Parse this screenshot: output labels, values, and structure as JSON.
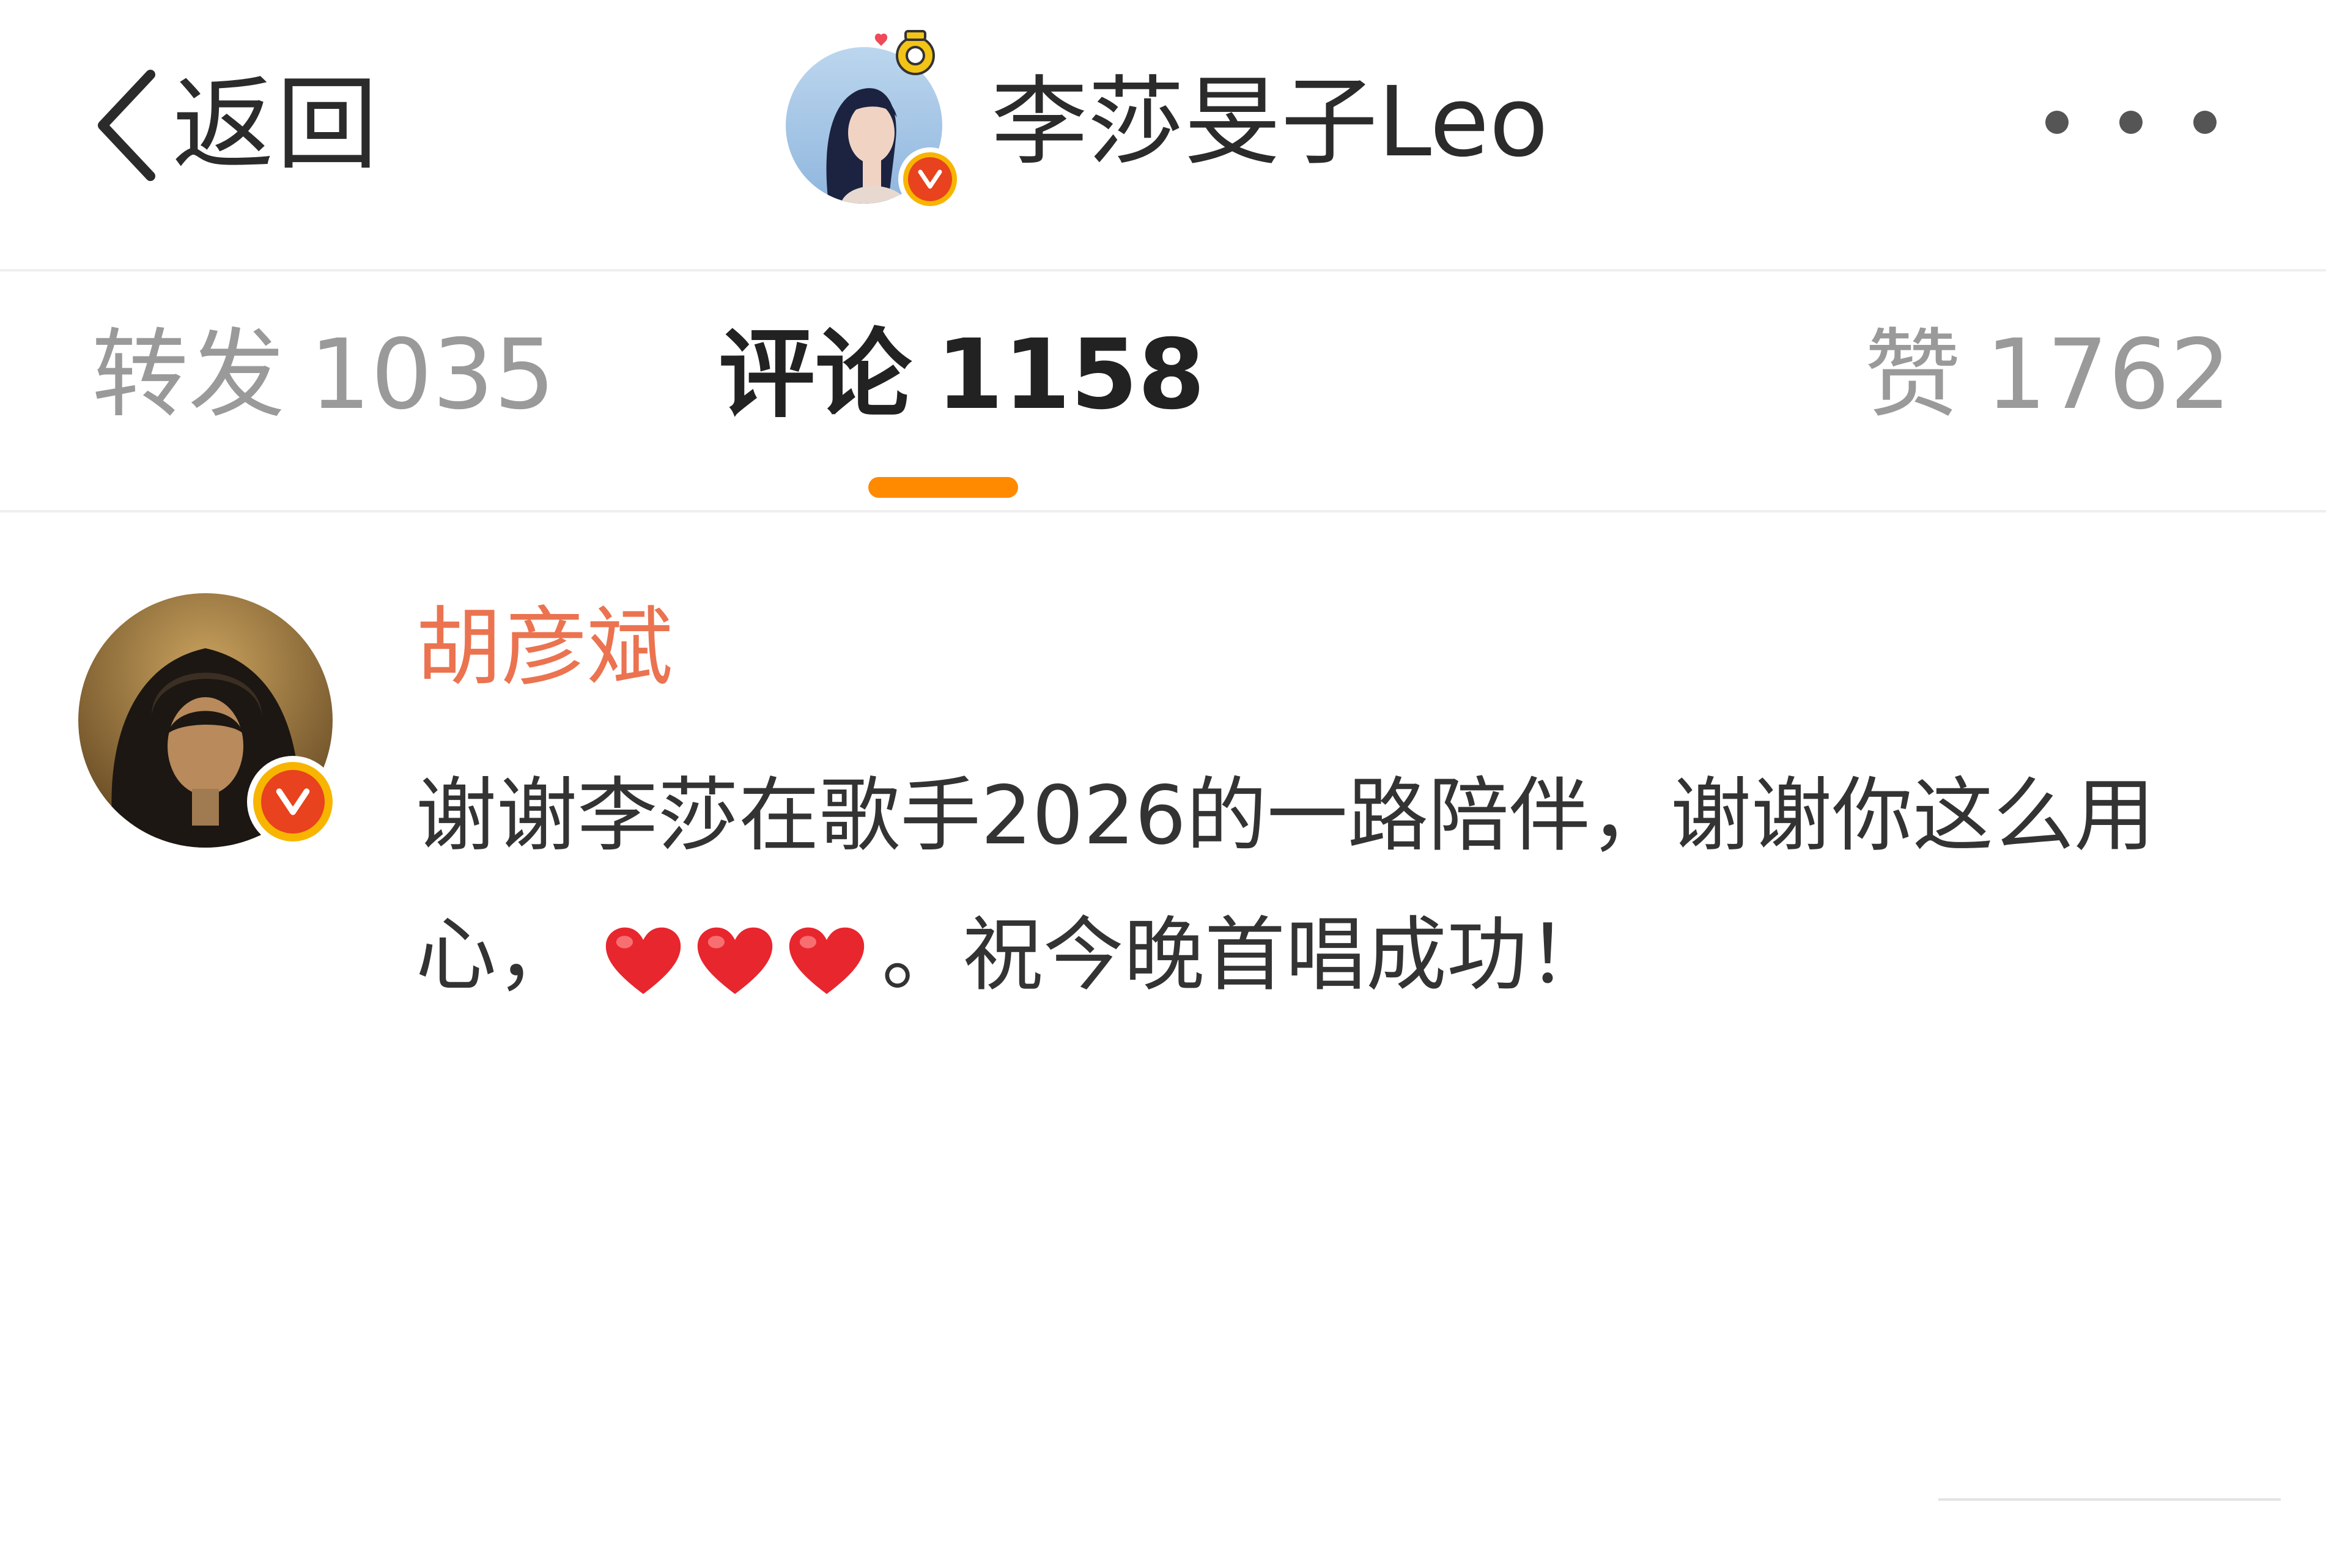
{
  "header": {
    "back_label": "返回",
    "profile_name": "李莎旻子Leo",
    "more_icon": "more-dots-icon"
  },
  "tabs": [
    {
      "label": "转发",
      "count": "1035",
      "active": false
    },
    {
      "label": "评论",
      "count": "1158",
      "active": true
    },
    {
      "label": "赞",
      "count": "1762",
      "active": false
    }
  ],
  "comment": {
    "author": "胡彦斌",
    "text_before": "谢谢李莎在歌手2026的一路陪伴，谢谢你这么用心，",
    "emoji": [
      "red-heart",
      "red-heart",
      "red-heart"
    ],
    "text_after": "。祝今晚首唱成功！"
  },
  "colors": {
    "accent": "#ff8a00",
    "author": "#eb7350",
    "verified_outer": "#f7b500",
    "verified_inner": "#e8421e",
    "heart": "#e8262e"
  }
}
